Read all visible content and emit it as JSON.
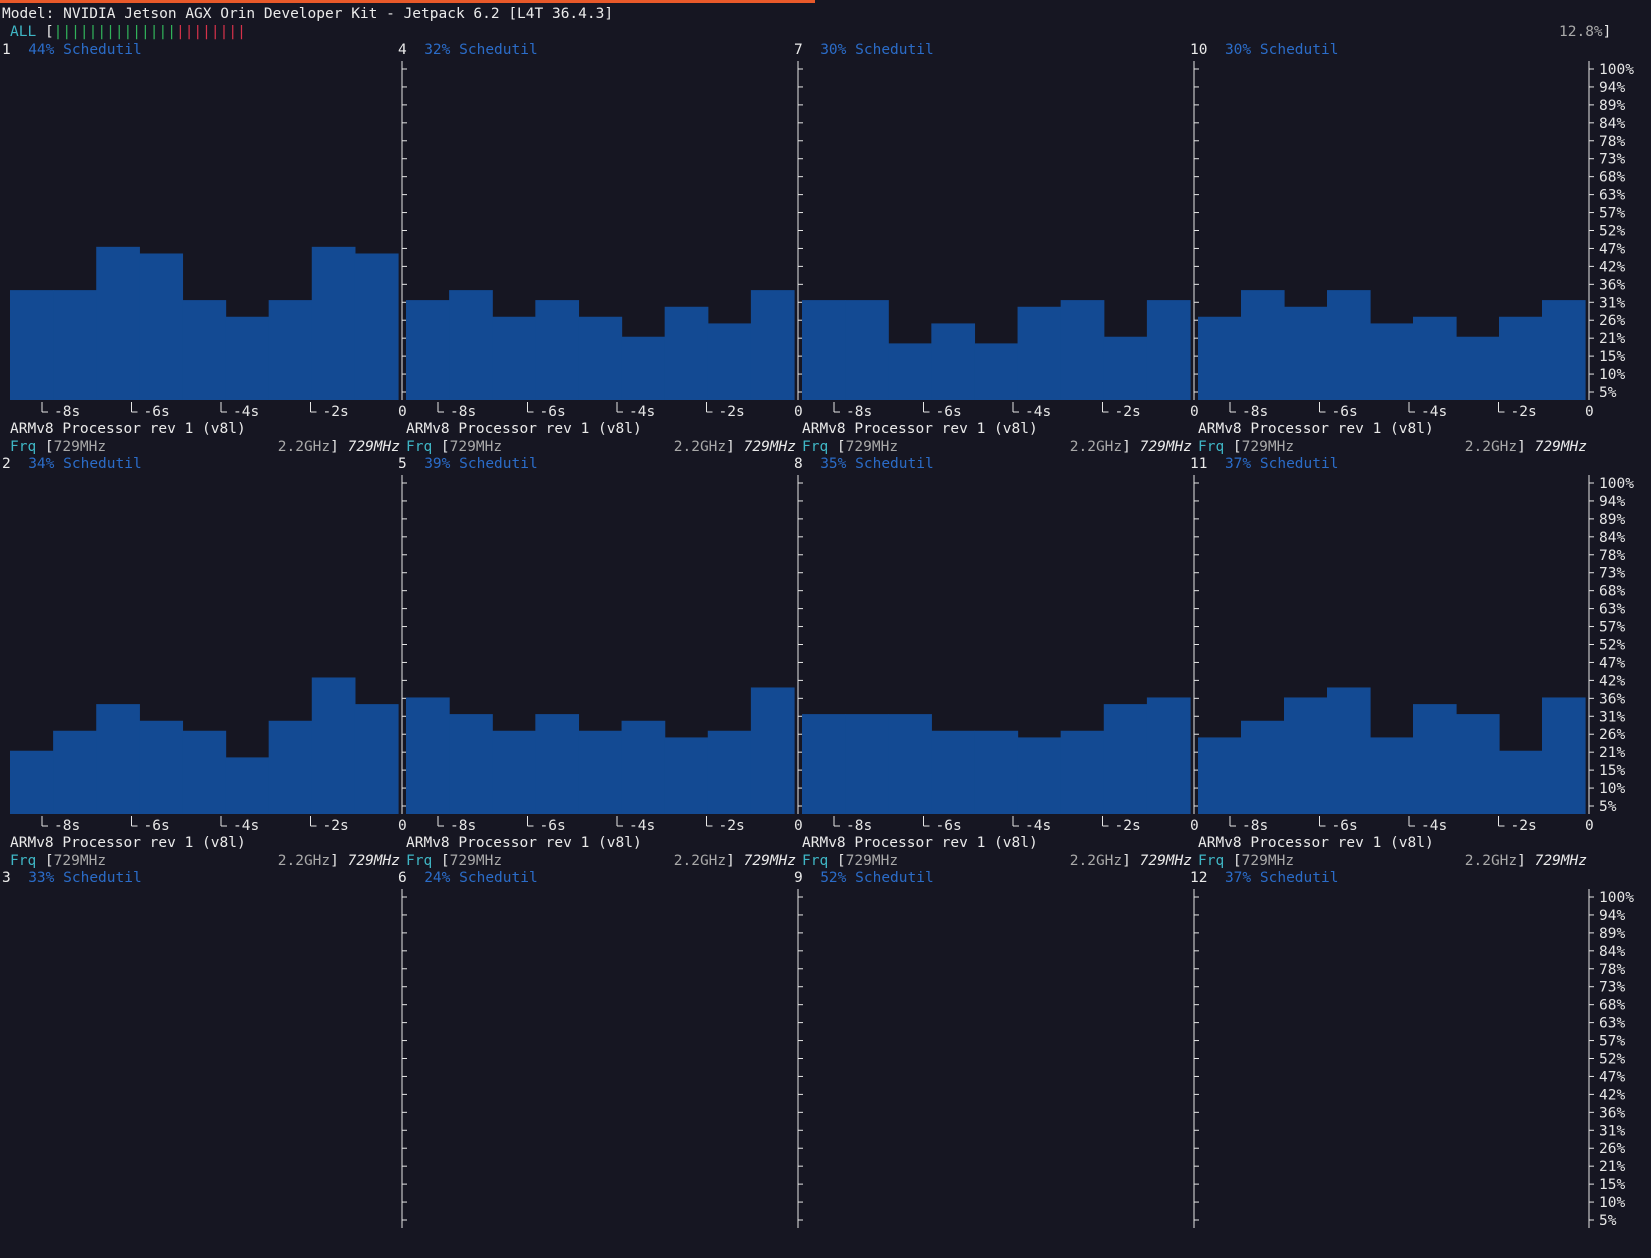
{
  "header": {
    "model_line": "Model: NVIDIA Jetson AGX Orin Developer Kit - Jetpack 6.2 [L4T 36.4.3]",
    "all_label": "ALL",
    "all_open": "[",
    "all_close": "]",
    "all_value": "12.8%",
    "all_green_bars": 14,
    "all_red_bars": 8,
    "all_progress": 12.8
  },
  "colors": {
    "bar_fill": "#134a93",
    "axis": "#e6e6e6",
    "accent": "#e8592a",
    "cyan": "#3fb6c5",
    "governor": "#2b6cc8"
  },
  "axis": {
    "x_ticks": [
      "-8s",
      "-6s",
      "-4s",
      "-2s"
    ],
    "x_end": "0",
    "y_ticks": [
      "100%",
      "94%",
      "89%",
      "84%",
      "78%",
      "73%",
      "68%",
      "63%",
      "57%",
      "52%",
      "47%",
      "42%",
      "36%",
      "31%",
      "26%",
      "21%",
      "15%",
      "10%",
      "5%"
    ]
  },
  "cpus": [
    {
      "id": "1",
      "percent": "44%",
      "governor": "Schedutil",
      "model": "ARMv8 Processor rev 1 (v8l)",
      "frq_label": "Frq",
      "frq_min": "729MHz",
      "frq_max": "2.2GHz",
      "frq_cur": "729MHz",
      "history": [
        33,
        33,
        46,
        44,
        30,
        25,
        30,
        46,
        44
      ]
    },
    {
      "id": "4",
      "percent": "32%",
      "governor": "Schedutil",
      "model": "ARMv8 Processor rev 1 (v8l)",
      "frq_label": "Frq",
      "frq_min": "729MHz",
      "frq_max": "2.2GHz",
      "frq_cur": "729MHz",
      "history": [
        30,
        33,
        25,
        30,
        25,
        19,
        28,
        23,
        33
      ]
    },
    {
      "id": "7",
      "percent": "30%",
      "governor": "Schedutil",
      "model": "ARMv8 Processor rev 1 (v8l)",
      "frq_label": "Frq",
      "frq_min": "729MHz",
      "frq_max": "2.2GHz",
      "frq_cur": "729MHz",
      "history": [
        30,
        30,
        17,
        23,
        17,
        28,
        30,
        19,
        30
      ]
    },
    {
      "id": "10",
      "percent": "30%",
      "governor": "Schedutil",
      "model": "ARMv8 Processor rev 1 (v8l)",
      "frq_label": "Frq",
      "frq_min": "729MHz",
      "frq_max": "2.2GHz",
      "frq_cur": "729MHz",
      "history": [
        25,
        33,
        28,
        33,
        23,
        25,
        19,
        25,
        30
      ]
    },
    {
      "id": "2",
      "percent": "34%",
      "governor": "Schedutil",
      "model": "ARMv8 Processor rev 1 (v8l)",
      "frq_label": "Frq",
      "frq_min": "729MHz",
      "frq_max": "2.2GHz",
      "frq_cur": "729MHz",
      "history": [
        19,
        25,
        33,
        28,
        25,
        17,
        28,
        41,
        33
      ]
    },
    {
      "id": "5",
      "percent": "39%",
      "governor": "Schedutil",
      "model": "ARMv8 Processor rev 1 (v8l)",
      "frq_label": "Frq",
      "frq_min": "729MHz",
      "frq_max": "2.2GHz",
      "frq_cur": "729MHz",
      "history": [
        35,
        30,
        25,
        30,
        25,
        28,
        23,
        25,
        38
      ]
    },
    {
      "id": "8",
      "percent": "35%",
      "governor": "Schedutil",
      "model": "ARMv8 Processor rev 1 (v8l)",
      "frq_label": "Frq",
      "frq_min": "729MHz",
      "frq_max": "2.2GHz",
      "frq_cur": "729MHz",
      "history": [
        30,
        30,
        30,
        25,
        25,
        23,
        25,
        33,
        35
      ]
    },
    {
      "id": "11",
      "percent": "37%",
      "governor": "Schedutil",
      "model": "ARMv8 Processor rev 1 (v8l)",
      "frq_label": "Frq",
      "frq_min": "729MHz",
      "frq_max": "2.2GHz",
      "frq_cur": "729MHz",
      "history": [
        23,
        28,
        35,
        38,
        23,
        33,
        30,
        19,
        35
      ]
    },
    {
      "id": "3",
      "percent": "33%",
      "governor": "Schedutil"
    },
    {
      "id": "6",
      "percent": "24%",
      "governor": "Schedutil"
    },
    {
      "id": "9",
      "percent": "52%",
      "governor": "Schedutil"
    },
    {
      "id": "12",
      "percent": "37%",
      "governor": "Schedutil"
    }
  ]
}
